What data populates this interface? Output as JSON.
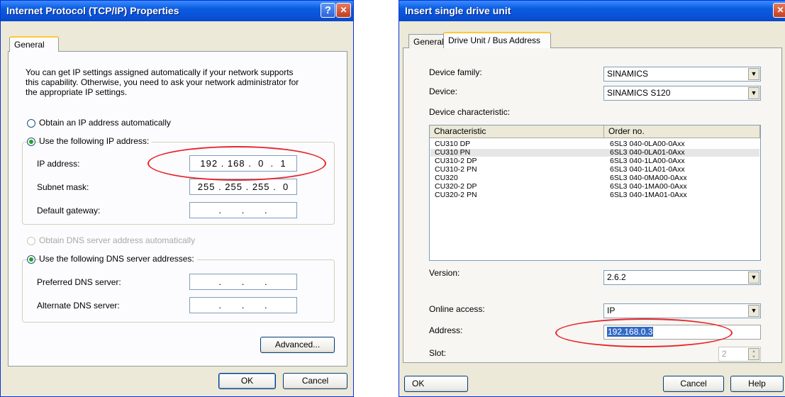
{
  "left_dialog": {
    "title": "Internet Protocol (TCP/IP) Properties",
    "help_glyph": "?",
    "close_glyph": "✕",
    "tab_general": "General",
    "description_line1": "You can get IP settings assigned automatically if your network supports",
    "description_line2": "this capability. Otherwise, you need to ask your network administrator for",
    "description_line3": "the appropriate IP settings.",
    "radio_obtain_ip": "Obtain an IP address automatically",
    "radio_use_ip": "Use the following IP address:",
    "ip_label": "IP address:",
    "ip_value": "192 . 168 .  0  .  1",
    "subnet_label": "Subnet mask:",
    "subnet_value": "255 . 255 . 255 .  0",
    "gateway_label": "Default gateway:",
    "gateway_value": " .      .      . ",
    "radio_obtain_dns": "Obtain DNS server address automatically",
    "radio_use_dns": "Use the following DNS server addresses:",
    "preferred_dns_label": "Preferred DNS server:",
    "preferred_dns_value": " .      .      . ",
    "alternate_dns_label": "Alternate DNS server:",
    "alternate_dns_value": " .      .      . ",
    "advanced_button": "Advanced...",
    "ok_button": "OK",
    "cancel_button": "Cancel"
  },
  "right_dialog": {
    "title": "Insert single drive unit",
    "close_glyph": "✕",
    "tab_general": "General",
    "tab_drive_unit": "Drive Unit / Bus Address",
    "device_family_label": "Device family:",
    "device_family_value": "SINAMICS",
    "device_label": "Device:",
    "device_value": "SINAMICS S120",
    "device_char_label": "Device characteristic:",
    "col_characteristic": "Characteristic",
    "col_order_no": "Order no.",
    "rows": [
      {
        "characteristic": "CU310 DP",
        "order_no": "6SL3 040-0LA00-0Axx"
      },
      {
        "characteristic": "CU310 PN",
        "order_no": "6SL3 040-0LA01-0Axx"
      },
      {
        "characteristic": "CU310-2 DP",
        "order_no": "6SL3 040-1LA00-0Axx"
      },
      {
        "characteristic": "CU310-2 PN",
        "order_no": "6SL3 040-1LA01-0Axx"
      },
      {
        "characteristic": "CU320",
        "order_no": "6SL3 040-0MA00-0Axx"
      },
      {
        "characteristic": "CU320-2 DP",
        "order_no": "6SL3 040-1MA00-0Axx"
      },
      {
        "characteristic": "CU320-2 PN",
        "order_no": "6SL3 040-1MA01-0Axx"
      }
    ],
    "version_label": "Version:",
    "version_value": "2.6.2",
    "online_access_label": "Online access:",
    "online_access_value": "IP",
    "address_label": "Address:",
    "address_value": "192.168.0.3",
    "slot_label": "Slot:",
    "slot_value": "2",
    "ok_button": "OK",
    "cancel_button": "Cancel",
    "help_button": "Help"
  },
  "colors": {
    "title_bar_blue": "#0a5be0",
    "dialog_face": "#ece9d8",
    "annotation_red": "#e8262b",
    "selection_blue": "#316ac5"
  }
}
